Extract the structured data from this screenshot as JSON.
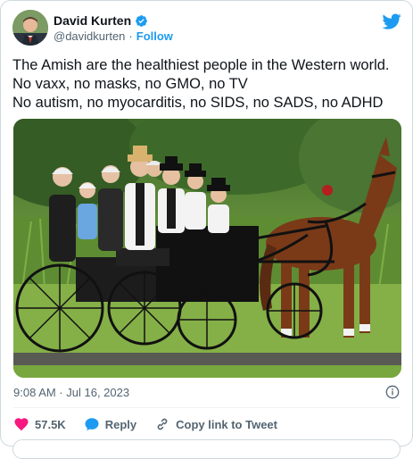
{
  "author": {
    "name": "David Kurten",
    "handle": "@davidkurten",
    "separator": "·",
    "follow_label": "Follow",
    "avatar_icon": "avatar-photo",
    "verified_icon": "verified-badge-icon"
  },
  "tweet": {
    "lines": [
      "The Amish are the healthiest people in the Western world.",
      "No vaxx, no masks, no GMO, no TV",
      "No autism, no myocarditis, no SIDS, no SADS, no ADHD"
    ],
    "timestamp": "9:08 AM · Jul 16, 2023"
  },
  "actions": {
    "like_count": "57.5K",
    "reply_label": "Reply",
    "copy_label": "Copy link to Tweet"
  },
  "colors": {
    "accent": "#1d9bf0",
    "like": "#f91880",
    "text": "#0f1419",
    "muted": "#536471"
  }
}
